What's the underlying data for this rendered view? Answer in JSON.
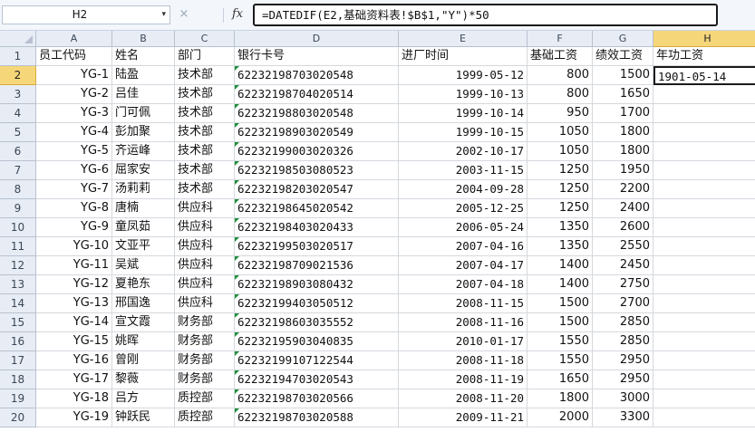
{
  "formula_bar": {
    "name_box": "H2",
    "name_box_arrow": "▾",
    "cancel_icon": "×",
    "fx_label": "fx",
    "formula": "=DATEDIF(E2,基础资料表!$B$1,\"Y\")*50"
  },
  "columns": [
    "A",
    "B",
    "C",
    "D",
    "E",
    "F",
    "G",
    "H"
  ],
  "selected_column": "H",
  "selected_row": "2",
  "header_row": [
    "员工代码",
    "姓名",
    "部门",
    "银行卡号",
    "进厂时间",
    "基础工资",
    "绩效工资",
    "年功工资"
  ],
  "rows": [
    {
      "r": "2",
      "code": "YG-1",
      "name": "陆盈",
      "dept": "技术部",
      "card": "62232198703020548",
      "date": "1999-05-12",
      "base": "800",
      "perf": "1500",
      "seniority": "1901-05-14"
    },
    {
      "r": "3",
      "code": "YG-2",
      "name": "吕佳",
      "dept": "技术部",
      "card": "62232198704020514",
      "date": "1999-10-13",
      "base": "800",
      "perf": "1650",
      "seniority": ""
    },
    {
      "r": "4",
      "code": "YG-3",
      "name": "门可佩",
      "dept": "技术部",
      "card": "62232198803020548",
      "date": "1999-10-14",
      "base": "950",
      "perf": "1700",
      "seniority": ""
    },
    {
      "r": "5",
      "code": "YG-4",
      "name": "彭加聚",
      "dept": "技术部",
      "card": "62232198903020549",
      "date": "1999-10-15",
      "base": "1050",
      "perf": "1800",
      "seniority": ""
    },
    {
      "r": "6",
      "code": "YG-5",
      "name": "齐运峰",
      "dept": "技术部",
      "card": "62232199003020326",
      "date": "2002-10-17",
      "base": "1050",
      "perf": "1800",
      "seniority": ""
    },
    {
      "r": "7",
      "code": "YG-6",
      "name": "屈家安",
      "dept": "技术部",
      "card": "62232198503080523",
      "date": "2003-11-15",
      "base": "1250",
      "perf": "1950",
      "seniority": ""
    },
    {
      "r": "8",
      "code": "YG-7",
      "name": "汤莉莉",
      "dept": "技术部",
      "card": "62232198203020547",
      "date": "2004-09-28",
      "base": "1250",
      "perf": "2200",
      "seniority": ""
    },
    {
      "r": "9",
      "code": "YG-8",
      "name": "唐楠",
      "dept": "供应科",
      "card": "62232198645020542",
      "date": "2005-12-25",
      "base": "1250",
      "perf": "2400",
      "seniority": ""
    },
    {
      "r": "10",
      "code": "YG-9",
      "name": "童凤茹",
      "dept": "供应科",
      "card": "62232198403020433",
      "date": "2006-05-24",
      "base": "1350",
      "perf": "2600",
      "seniority": ""
    },
    {
      "r": "11",
      "code": "YG-10",
      "name": "文亚平",
      "dept": "供应科",
      "card": "62232199503020517",
      "date": "2007-04-16",
      "base": "1350",
      "perf": "2550",
      "seniority": ""
    },
    {
      "r": "12",
      "code": "YG-11",
      "name": "吴斌",
      "dept": "供应科",
      "card": "62232198709021536",
      "date": "2007-04-17",
      "base": "1400",
      "perf": "2450",
      "seniority": ""
    },
    {
      "r": "13",
      "code": "YG-12",
      "name": "夏艳东",
      "dept": "供应科",
      "card": "62232198903080432",
      "date": "2007-04-18",
      "base": "1400",
      "perf": "2750",
      "seniority": ""
    },
    {
      "r": "14",
      "code": "YG-13",
      "name": "邢国逸",
      "dept": "供应科",
      "card": "62232199403050512",
      "date": "2008-11-15",
      "base": "1500",
      "perf": "2700",
      "seniority": ""
    },
    {
      "r": "15",
      "code": "YG-14",
      "name": "宣文霞",
      "dept": "财务部",
      "card": "62232198603035552",
      "date": "2008-11-16",
      "base": "1500",
      "perf": "2850",
      "seniority": ""
    },
    {
      "r": "16",
      "code": "YG-15",
      "name": "姚晖",
      "dept": "财务部",
      "card": "62232195903040835",
      "date": "2010-01-17",
      "base": "1550",
      "perf": "2850",
      "seniority": ""
    },
    {
      "r": "17",
      "code": "YG-16",
      "name": "曾刚",
      "dept": "财务部",
      "card": "62232199107122544",
      "date": "2008-11-18",
      "base": "1550",
      "perf": "2950",
      "seniority": ""
    },
    {
      "r": "18",
      "code": "YG-17",
      "name": "黎薇",
      "dept": "财务部",
      "card": "62232194703020543",
      "date": "2008-11-19",
      "base": "1650",
      "perf": "2950",
      "seniority": ""
    },
    {
      "r": "19",
      "code": "YG-18",
      "name": "吕方",
      "dept": "质控部",
      "card": "62232198703020566",
      "date": "2008-11-20",
      "base": "1800",
      "perf": "3000",
      "seniority": ""
    },
    {
      "r": "20",
      "code": "YG-19",
      "name": "钟跃民",
      "dept": "质控部",
      "card": "62232198703020588",
      "date": "2009-11-21",
      "base": "2000",
      "perf": "3300",
      "seniority": ""
    }
  ]
}
